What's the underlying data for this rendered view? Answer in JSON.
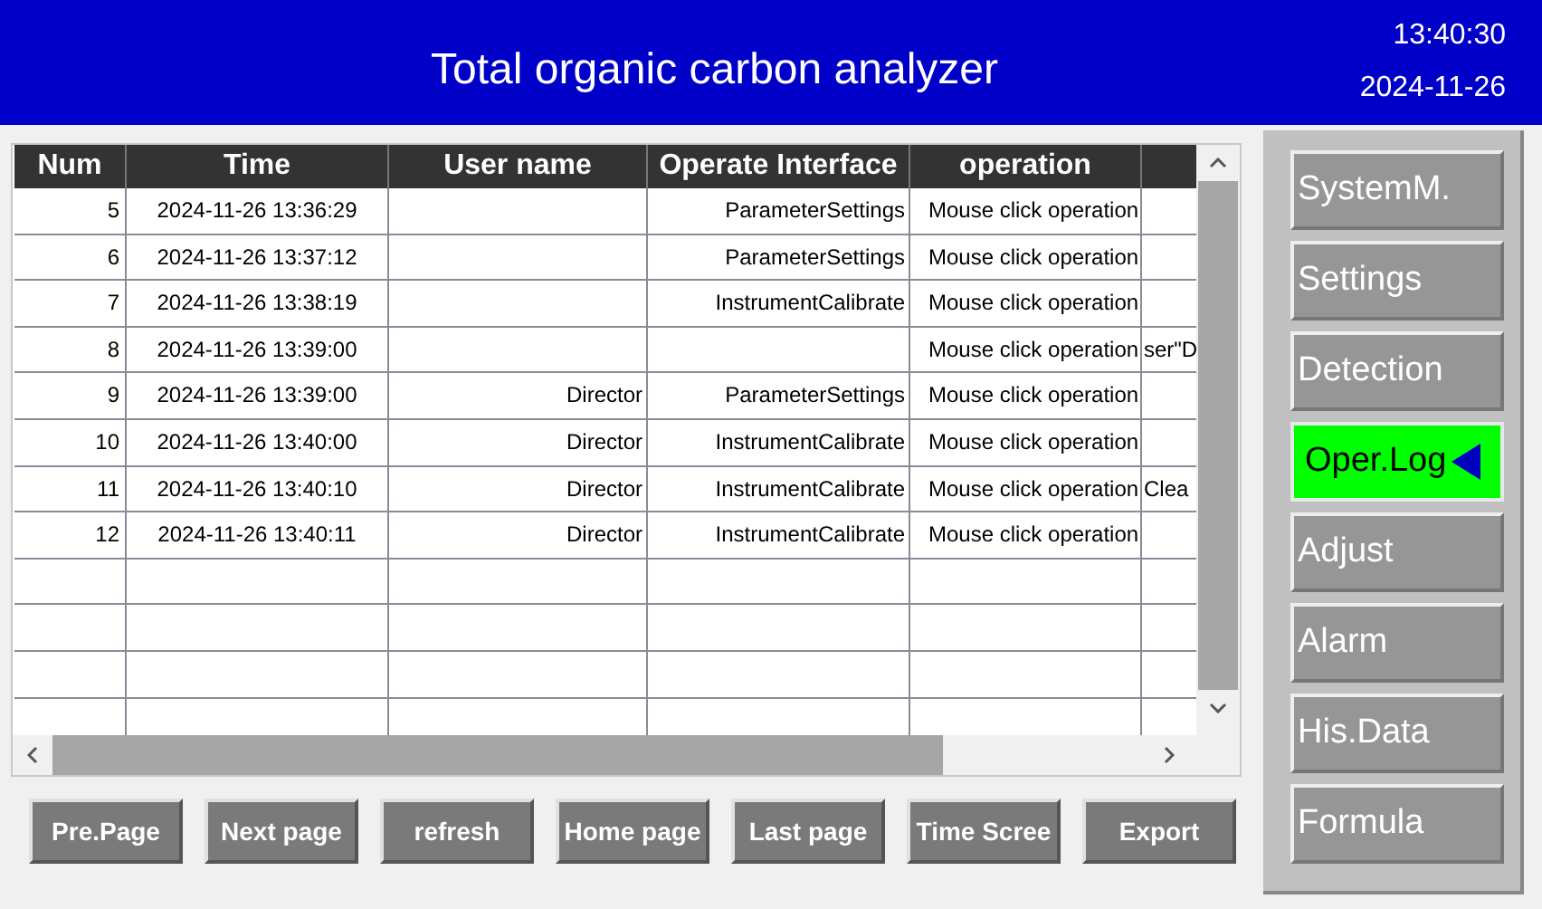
{
  "header": {
    "title": "Total organic carbon analyzer",
    "time": "13:40:30",
    "date": "2024-11-26"
  },
  "table": {
    "columns": [
      "Num",
      "Time",
      "User name",
      "Operate Interface",
      "operation"
    ],
    "rows": [
      {
        "num": "5",
        "time": "2024-11-26 13:36:29",
        "operate_interface": "ParameterSettings",
        "operation": "Mouse click operation"
      },
      {
        "num": "6",
        "time": "2024-11-26 13:37:12",
        "operate_interface": "ParameterSettings",
        "operation": "Mouse click operation"
      },
      {
        "num": "7",
        "time": "2024-11-26 13:38:19",
        "operate_interface": "InstrumentCalibrate",
        "operation": "Mouse click operation"
      },
      {
        "num": "8",
        "time": "2024-11-26 13:39:00",
        "operation": "Mouse click operation",
        "column_6": "ser\"D"
      },
      {
        "num": "9",
        "time": "2024-11-26 13:39:00",
        "user_name": "Director",
        "operate_interface": "ParameterSettings",
        "operation": "Mouse click operation"
      },
      {
        "num": "10",
        "time": "2024-11-26 13:40:00",
        "user_name": "Director",
        "operate_interface": "InstrumentCalibrate",
        "operation": "Mouse click operation"
      },
      {
        "num": "11",
        "time": "2024-11-26 13:40:10",
        "user_name": "Director",
        "operate_interface": "InstrumentCalibrate",
        "operation": "Mouse click operation",
        "column_6": "Clea"
      },
      {
        "num": "12",
        "time": "2024-11-26 13:40:11",
        "user_name": "Director",
        "operate_interface": "InstrumentCalibrate",
        "operation": "Mouse click operation"
      }
    ]
  },
  "buttons": [
    "Pre.Page",
    "Next page",
    "refresh",
    "Home page",
    "Last page",
    "Time Scree",
    "Export"
  ],
  "sidebar": {
    "items": [
      {
        "label": "SystemM.",
        "selected": false
      },
      {
        "label": "Settings",
        "selected": false
      },
      {
        "label": "Detection",
        "selected": false
      },
      {
        "label": "Oper.Log",
        "selected": true
      },
      {
        "label": "Adjust",
        "selected": false
      },
      {
        "label": "Alarm",
        "selected": false
      },
      {
        "label": "His.Data",
        "selected": false
      },
      {
        "label": "Formula",
        "selected": false
      }
    ]
  }
}
